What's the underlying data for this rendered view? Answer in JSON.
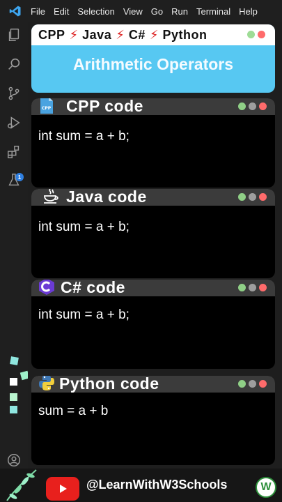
{
  "menubar": {
    "items": [
      "File",
      "Edit",
      "Selection",
      "View",
      "Go",
      "Run",
      "Terminal",
      "Help"
    ]
  },
  "activity": {
    "icons": [
      "explorer-icon",
      "search-icon",
      "source-control-icon",
      "run-debug-icon",
      "extensions-icon",
      "testing-icon",
      "account-icon"
    ],
    "extensions_badge": "1"
  },
  "title_card": {
    "languages": [
      "CPP",
      "Java",
      "C#",
      "Python"
    ],
    "title": "Arithmetic Operators",
    "color": "#57c8f2"
  },
  "panels": [
    {
      "title": "CPP code",
      "code": "int sum = a + b;",
      "icon": "cpp-file-icon"
    },
    {
      "title": "Java code",
      "code": "int sum = a + b;",
      "icon": "java-coffee-icon"
    },
    {
      "title": "C# code",
      "code": "int sum = a + b;",
      "icon": "csharp-icon"
    },
    {
      "title": "Python code",
      "code": "sum = a + b",
      "icon": "python-icon"
    }
  ],
  "footer": {
    "handle": "@LearnWithW3Schools",
    "logo_letter": "W"
  },
  "colors": {
    "dot_green": "#8fcf86",
    "dot_red": "#ff6b6b",
    "dot_grey": "#9e9e9e",
    "youtube_red": "#e8201d"
  }
}
